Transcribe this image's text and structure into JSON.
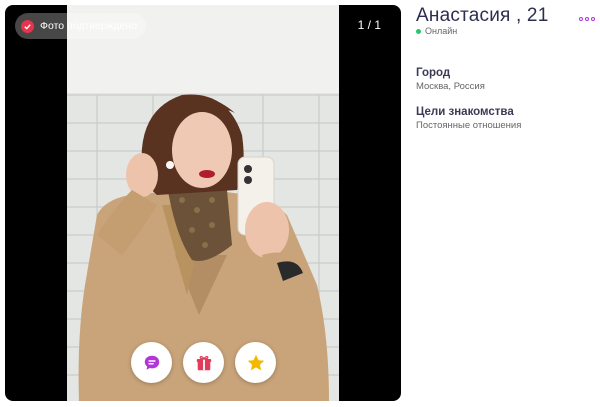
{
  "photo": {
    "verified_label": "Фото подтверждено",
    "counter": "1 / 1"
  },
  "actions": [
    {
      "icon": "message-icon",
      "color": "#b235d8"
    },
    {
      "icon": "gift-icon",
      "color": "#e23c5b"
    },
    {
      "icon": "star-icon",
      "color": "#f5b800"
    }
  ],
  "profile": {
    "name": "Анастасия , 21",
    "status": "Онлайн"
  },
  "info": {
    "city_label": "Город",
    "city_value": "Москва, Россия",
    "goals_label": "Цели знакомства",
    "goals_value": "Постоянные отношения"
  },
  "colors": {
    "accent": "#b235d8",
    "online": "#2cc46a",
    "verified": "#e5344c"
  }
}
